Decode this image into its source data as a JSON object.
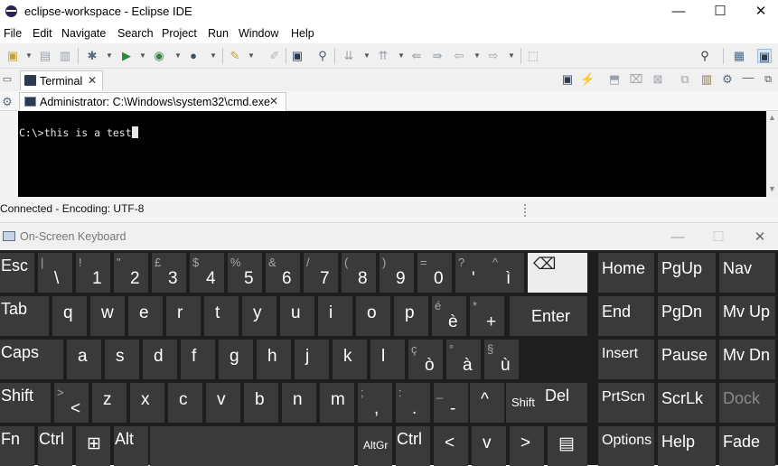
{
  "window": {
    "title": "eclipse-workspace - Eclipse IDE",
    "minimize": "—",
    "maximize": "☐",
    "close": "✕"
  },
  "menu": [
    "File",
    "Edit",
    "Navigate",
    "Search",
    "Project",
    "Run",
    "Window",
    "Help"
  ],
  "view_tab": {
    "label": "Terminal",
    "close": "✕"
  },
  "console_tab": {
    "label": "Administrator: C:\\Windows\\system32\\cmd.exe",
    "close": "✕"
  },
  "console": {
    "prompt": "C:\\>",
    "input": "this is a test"
  },
  "status": {
    "text": "Connected - Encoding: UTF-8"
  },
  "osk": {
    "title": "On-Screen Keyboard",
    "minimize": "—",
    "maximize": "☐",
    "close": "✕",
    "row1": [
      {
        "main": "Esc",
        "shift": ""
      },
      {
        "main": "\\",
        "shift": "|"
      },
      {
        "main": "1",
        "shift": "!"
      },
      {
        "main": "2",
        "shift": "\""
      },
      {
        "main": "3",
        "shift": "£"
      },
      {
        "main": "4",
        "shift": "$"
      },
      {
        "main": "5",
        "shift": "%"
      },
      {
        "main": "6",
        "shift": "&"
      },
      {
        "main": "7",
        "shift": "/"
      },
      {
        "main": "8",
        "shift": "("
      },
      {
        "main": "9",
        "shift": ")"
      },
      {
        "main": "0",
        "shift": "="
      },
      {
        "main": "'",
        "shift": "?"
      },
      {
        "main": "ì",
        "shift": "^"
      },
      {
        "main": "⌫",
        "shift": ""
      }
    ],
    "row2": [
      {
        "main": "Tab",
        "shift": ""
      },
      {
        "main": "q",
        "shift": ""
      },
      {
        "main": "w",
        "shift": ""
      },
      {
        "main": "e",
        "shift": ""
      },
      {
        "main": "r",
        "shift": ""
      },
      {
        "main": "t",
        "shift": ""
      },
      {
        "main": "y",
        "shift": ""
      },
      {
        "main": "u",
        "shift": ""
      },
      {
        "main": "i",
        "shift": ""
      },
      {
        "main": "o",
        "shift": ""
      },
      {
        "main": "p",
        "shift": ""
      },
      {
        "main": "è",
        "shift": "é"
      },
      {
        "main": "+",
        "shift": "*"
      },
      {
        "main": "Enter",
        "shift": ""
      }
    ],
    "row3": [
      {
        "main": "Caps",
        "shift": ""
      },
      {
        "main": "a",
        "shift": ""
      },
      {
        "main": "s",
        "shift": ""
      },
      {
        "main": "d",
        "shift": ""
      },
      {
        "main": "f",
        "shift": ""
      },
      {
        "main": "g",
        "shift": ""
      },
      {
        "main": "h",
        "shift": ""
      },
      {
        "main": "j",
        "shift": ""
      },
      {
        "main": "k",
        "shift": ""
      },
      {
        "main": "l",
        "shift": ""
      },
      {
        "main": "ò",
        "shift": "ç"
      },
      {
        "main": "à",
        "shift": "°"
      },
      {
        "main": "ù",
        "shift": "§"
      }
    ],
    "row4": [
      {
        "main": "Shift",
        "shift": ""
      },
      {
        "main": "<",
        "shift": ">"
      },
      {
        "main": "z",
        "shift": ""
      },
      {
        "main": "x",
        "shift": ""
      },
      {
        "main": "c",
        "shift": ""
      },
      {
        "main": "v",
        "shift": ""
      },
      {
        "main": "b",
        "shift": ""
      },
      {
        "main": "n",
        "shift": ""
      },
      {
        "main": "m",
        "shift": ""
      },
      {
        "main": ",",
        "shift": ";"
      },
      {
        "main": ".",
        "shift": ":"
      },
      {
        "main": "-",
        "shift": "_"
      },
      {
        "main": "^",
        "shift": ""
      },
      {
        "main": "Shift",
        "shift": ""
      },
      {
        "main": "Del",
        "shift": ""
      }
    ],
    "row5": [
      {
        "main": "Fn",
        "shift": ""
      },
      {
        "main": "Ctrl",
        "shift": ""
      },
      {
        "main": "⊞",
        "shift": ""
      },
      {
        "main": "Alt",
        "shift": ""
      },
      {
        "main": "",
        "shift": ""
      },
      {
        "main": "AltGr",
        "shift": ""
      },
      {
        "main": "Ctrl",
        "shift": ""
      },
      {
        "main": "<",
        "shift": ""
      },
      {
        "main": "v",
        "shift": ""
      },
      {
        "main": ">",
        "shift": ""
      },
      {
        "main": "▤",
        "shift": ""
      }
    ],
    "nav": [
      [
        "Home",
        "PgUp",
        "Nav"
      ],
      [
        "End",
        "PgDn",
        "Mv Up"
      ],
      [
        "Insert",
        "Pause",
        "Mv Dn"
      ],
      [
        "PrtScn",
        "ScrLk",
        "Dock"
      ],
      [
        "Options",
        "Help",
        "Fade"
      ]
    ]
  }
}
